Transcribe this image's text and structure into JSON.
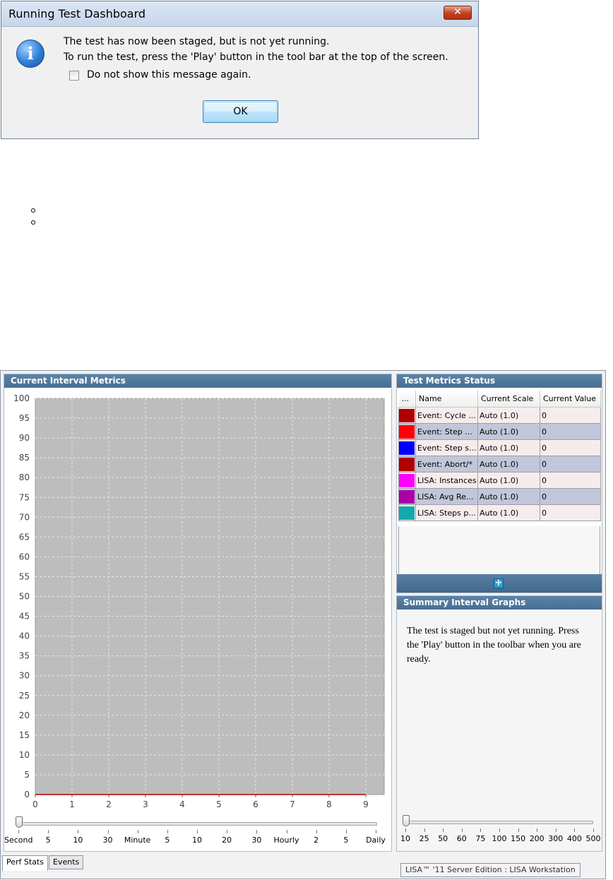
{
  "dialog": {
    "title": "Running Test Dashboard",
    "close_glyph": "✕",
    "icon": "info-icon",
    "message_line1": "The test has now been staged, but is not yet running.",
    "message_line2": "To run the test, press the 'Play' button in the tool bar at the top of the screen.",
    "checkbox_label": "Do not show this message again.",
    "checkbox_checked": false,
    "ok_label": "OK"
  },
  "bullets": [
    "",
    ""
  ],
  "chart_panel": {
    "title": "Current Interval Metrics"
  },
  "chart_data": {
    "type": "line",
    "title": "Current Interval Metrics",
    "xlabel": "",
    "ylabel": "",
    "x_ticks": [
      "0",
      "1",
      "2",
      "3",
      "4",
      "5",
      "6",
      "7",
      "8",
      "9"
    ],
    "y_ticks": [
      "0",
      "5",
      "10",
      "15",
      "20",
      "25",
      "30",
      "35",
      "40",
      "45",
      "50",
      "55",
      "60",
      "65",
      "70",
      "75",
      "80",
      "85",
      "90",
      "95",
      "100"
    ],
    "xlim": [
      0,
      9
    ],
    "ylim": [
      0,
      100
    ],
    "grid": true,
    "plot_background": "#bdbdbd",
    "series": [
      {
        "color": "#b00000",
        "x": [
          0,
          9
        ],
        "y": [
          0,
          0
        ]
      }
    ]
  },
  "time_slider": {
    "value_label": "Second",
    "labels": [
      "Second",
      "5",
      "10",
      "30",
      "Minute",
      "5",
      "10",
      "20",
      "30",
      "Hourly",
      "2",
      "5",
      "Daily"
    ]
  },
  "metrics_panel": {
    "title": "Test Metrics Status",
    "columns": [
      "...",
      "Name",
      "Current Scale",
      "Current Value"
    ],
    "rows": [
      {
        "color": "#b00000",
        "name": "Event: Cycle ...",
        "scale": "Auto (1.0)",
        "value": "0"
      },
      {
        "color": "#ff0000",
        "name": "Event: Step ...",
        "scale": "Auto (1.0)",
        "value": "0"
      },
      {
        "color": "#0000ff",
        "name": "Event: Step s...",
        "scale": "Auto (1.0)",
        "value": "0"
      },
      {
        "color": "#b00000",
        "name": "Event: Abort/*",
        "scale": "Auto (1.0)",
        "value": "0"
      },
      {
        "color": "#ff00ff",
        "name": "LISA: Instances",
        "scale": "Auto (1.0)",
        "value": "0"
      },
      {
        "color": "#aa00aa",
        "name": "LISA: Avg Re...",
        "scale": "Auto (1.0)",
        "value": "0"
      },
      {
        "color": "#11aaaa",
        "name": "LISA: Steps p...",
        "scale": "Auto (1.0)",
        "value": "0"
      }
    ],
    "add_icon": "plus-icon"
  },
  "summary_panel": {
    "title": "Summary Interval Graphs",
    "message": "The test is staged but not yet running. Press the 'Play' button in the toolbar when you are ready."
  },
  "summary_slider": {
    "labels": [
      "10",
      "25",
      "50",
      "60",
      "75",
      "100",
      "150",
      "200",
      "300",
      "400",
      "500"
    ]
  },
  "tabs": [
    {
      "label": "Perf Stats",
      "active": true
    },
    {
      "label": "Events",
      "active": false
    }
  ],
  "status_bar": "LISA™ '11 Server Edition : LISA Workstation"
}
